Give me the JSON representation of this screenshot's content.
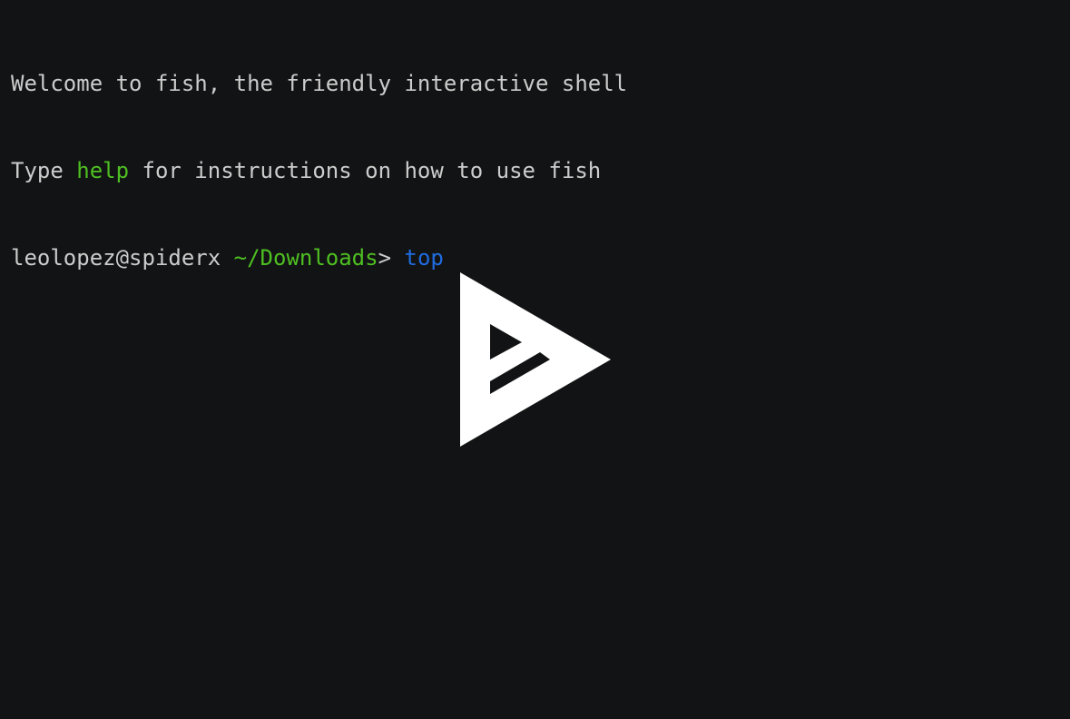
{
  "terminal": {
    "background": "#121314",
    "foreground": "#cccccc",
    "colors": {
      "green": "#4ebf22",
      "blue": "#1f6ce0"
    },
    "line1": {
      "text": "Welcome to fish, the friendly interactive shell"
    },
    "line2": {
      "pre": "Type ",
      "keyword": "help",
      "post": " for instructions on how to use fish"
    },
    "prompt": {
      "user_host": "leolopez@spiderx",
      "space": " ",
      "cwd": "~/Downloads",
      "symbol": "> ",
      "command": "top"
    }
  },
  "overlay": {
    "icon": "asciinema-play-icon",
    "color": "#ffffff"
  }
}
